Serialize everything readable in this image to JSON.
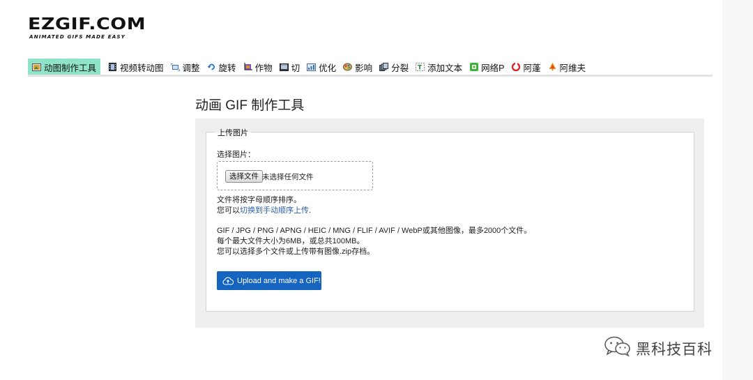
{
  "logo": {
    "main": "EZGIF.COM",
    "tagline": "ANIMATED GIFS MADE EASY"
  },
  "nav": {
    "items": [
      {
        "label": "动图制作工具",
        "icon": "film-icon",
        "active": true
      },
      {
        "label": "视频转动图",
        "icon": "video-icon",
        "active": false
      },
      {
        "label": "调整",
        "icon": "resize-icon",
        "active": false
      },
      {
        "label": "旋转",
        "icon": "rotate-icon",
        "active": false
      },
      {
        "label": "作物",
        "icon": "crop-icon",
        "active": false
      },
      {
        "label": "切",
        "icon": "cut-icon",
        "active": false
      },
      {
        "label": "优化",
        "icon": "optimize-icon",
        "active": false
      },
      {
        "label": "影响",
        "icon": "effects-icon",
        "active": false
      },
      {
        "label": "分裂",
        "icon": "split-icon",
        "active": false
      },
      {
        "label": "添加文本",
        "icon": "text-icon",
        "active": false
      },
      {
        "label": "网络P",
        "icon": "webp-icon",
        "active": false
      },
      {
        "label": "阿蓬",
        "icon": "apng-icon",
        "active": false
      },
      {
        "label": "阿维夫",
        "icon": "avif-icon",
        "active": false
      }
    ]
  },
  "page": {
    "title": "动画 GIF 制作工具"
  },
  "upload": {
    "legend": "上传图片",
    "choose_label": "选择图片：",
    "file_button": "选择文件",
    "no_file": "未选择任何文件",
    "sort_note": "文件将按字母顺序排序。",
    "manual_prefix": "您可以",
    "manual_link": "切换到手动顺序上传",
    "manual_suffix": ".",
    "formats_line": "GIF / JPG / PNG / APNG / HEIC / MNG / FLIF / AVIF / WebP或其他图像，最多2000个文件。",
    "size_line": "每个最大文件大小为6MB，或总共100MB。",
    "zip_line": "您可以选择多个文件或上传带有图像.zip存档。",
    "submit_label": "Upload and make a GIF!"
  },
  "watermark": {
    "text": "黑科技百科",
    "icon": "wechat-icon"
  },
  "colors": {
    "active_tab": "#8fe3c9",
    "primary_button": "#1565c0",
    "link": "#2b5fad",
    "panel_bg": "#efefef"
  }
}
